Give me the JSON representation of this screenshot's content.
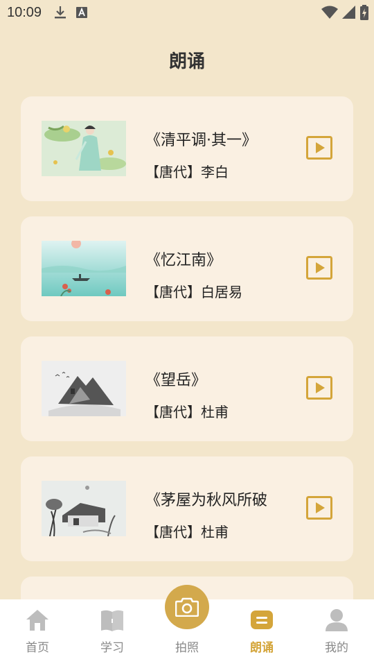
{
  "status_bar": {
    "time": "10:09",
    "icons": [
      "download-icon",
      "a-icon",
      "wifi-icon",
      "signal-icon",
      "battery-icon"
    ]
  },
  "header": {
    "title": "朗诵"
  },
  "poems": [
    {
      "title": "《清平调·其一》",
      "author": "【唐代】李白",
      "thumbnail": "lady-painting"
    },
    {
      "title": "《忆江南》",
      "author": "【唐代】白居易",
      "thumbnail": "river-boat-painting"
    },
    {
      "title": "《望岳》",
      "author": "【唐代】杜甫",
      "thumbnail": "mountain-ink-painting"
    },
    {
      "title": "《茅屋为秋风所破",
      "author": "【唐代】杜甫",
      "thumbnail": "thatched-cottage-ink-painting"
    }
  ],
  "nav": {
    "items": [
      {
        "label": "首页",
        "icon": "home-icon"
      },
      {
        "label": "学习",
        "icon": "book-icon"
      },
      {
        "label": "拍照",
        "icon": "camera-icon"
      },
      {
        "label": "朗诵",
        "icon": "recite-icon"
      },
      {
        "label": "我的",
        "icon": "profile-icon"
      }
    ],
    "active_index": 3
  },
  "colors": {
    "background": "#f3e6cb",
    "card": "#faf0e2",
    "accent": "#d4a53a",
    "camera_button": "#d3a94c",
    "inactive_nav": "#bdbdbd"
  }
}
